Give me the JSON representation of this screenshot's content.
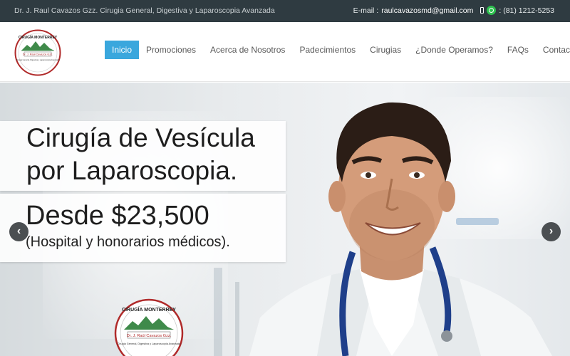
{
  "topbar": {
    "tagline": "Dr. J. Raul Cavazos Gzz. Cirugia General, Digestiva y Laparoscopia Avanzada",
    "email_label": "E-mail :",
    "email": "raulcavazosmd@gmail.com",
    "phone": ": (81) 1212-5253",
    "icons": [
      "phone-icon",
      "whatsapp-icon"
    ]
  },
  "logo": {
    "top_text": "CIRUGÍA MONTERREY",
    "name": "Dr. J. Raúl Cavazos Gzz.",
    "subtitle": "Cirugía General, Digestiva y Laparoscopia Avanzada"
  },
  "nav": {
    "items": [
      "Inicio",
      "Promociones",
      "Acerca de Nosotros",
      "Padecimientos",
      "Cirugias",
      "¿Donde Operamos?",
      "FAQs",
      "Contacto"
    ],
    "active_index": 0
  },
  "hero": {
    "headline_line1": "Cirugía de Vesícula",
    "headline_line2": "por Laparoscopia.",
    "price": "Desde $23,500",
    "price_note": "(Hospital y honorarios médicos).",
    "prev_icon": "chevron-left-icon",
    "next_icon": "chevron-right-icon"
  },
  "colors": {
    "topbar_bg": "#2f3b41",
    "accent": "#3aa7dd",
    "logo_red": "#b02a2a",
    "logo_green": "#3f8a4a"
  }
}
